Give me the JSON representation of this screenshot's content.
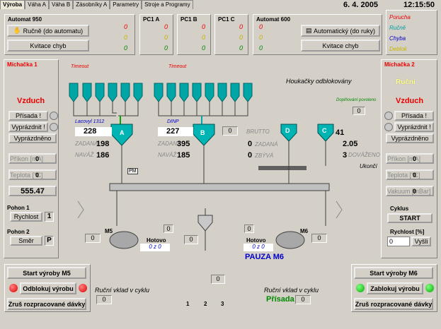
{
  "tabs": [
    "Výroba",
    "Váha A",
    "Váha B",
    "Zásobníky A",
    "Parametry",
    "Stroje a Programy"
  ],
  "date": "6. 4. 2005",
  "time": "12:15:50",
  "legend": {
    "porucha": "Porucha",
    "rucne": "Ručně",
    "chyba": "Chyba",
    "deblok": "Deblok"
  },
  "automat950": {
    "title": "Automat 950",
    "mode_btn": "Ručně (do automatu)",
    "reset_btn": "Kvitace chyb",
    "v1": "0",
    "v2": "0",
    "v3": "0"
  },
  "pc1a": {
    "title": "PC1 A",
    "v1": "0",
    "v2": "0",
    "v3": "0"
  },
  "pc1b": {
    "title": "PC1 B",
    "v1": "0",
    "v2": "0",
    "v3": "0"
  },
  "pc1c": {
    "title": "PC1 C",
    "v1": "0",
    "v2": "0",
    "v3": "0"
  },
  "automat600": {
    "title": "Automat 600",
    "mode_btn": "Automatický (do ruky)",
    "reset_btn": "Kvitace chyb",
    "v1": "0",
    "v2": "0",
    "v3": "0"
  },
  "m1": {
    "title": "Míchačka 1",
    "state": "Vzduch",
    "prisada": "Přísada !",
    "vyprazdnit": "Vyprázdnit !",
    "vyprazdneno": "Vyprázdněno",
    "prikon": "Příkon [mA]",
    "teplota": "Teplota [°C]",
    "v1": "0",
    "v2": "0",
    "v3": "555.47",
    "pohon1": "Pohon 1",
    "rychlost": "Rychlost",
    "rychlost_val": "1",
    "pohon2": "Pohon 2",
    "smer": "Směr",
    "smer_val": "P"
  },
  "m2": {
    "title": "Míchačka 2",
    "mode": "Ruční",
    "state": "Vzduch",
    "prisada": "Přísada !",
    "vyprazdnit": "Vyprázdnit !",
    "vyprazdneno": "Vyprázdněno",
    "prikon": "Příkon [mA]",
    "teplota": "Teplota [°C]",
    "vakuum": "Vakuum [mBar]",
    "v1": "0",
    "v2": "0",
    "v3": "0",
    "cyklus": "Cyklus",
    "start": "START",
    "rychlost": "Rychlost [%]",
    "rychlost_val": "0",
    "vysli": "Vyšli"
  },
  "timeout1": "Timeout",
  "timeout2": "Timeout",
  "houkacky": "Houkačky odblokovány",
  "doplnovani": "Doplňování povoleno",
  "dopl_val": "0",
  "vahaA": {
    "name": "Lacovyl 1312",
    "letter": "A",
    "brutto": "228",
    "zadana": "198",
    "naváž": "186",
    "pm": "PM"
  },
  "vahaB": {
    "name": "DINP",
    "letter": "B",
    "brutto": "227",
    "zadana": "395",
    "naváž": "185",
    "side": "0"
  },
  "vahaD": {
    "letter": "D",
    "brutto": "0",
    "zadana": "0",
    "zbyva": "0"
  },
  "vahaC": {
    "letter": "C",
    "brutto": "41",
    "zadana": "2.05",
    "dvazeno": "3"
  },
  "lbl": {
    "brutto": "BRUTTO",
    "zadana": "ZADANÁ",
    "navaz": "NAVÁŽ",
    "zbyva": "ZBÝVÁ",
    "dovazeno": "DOVÁŽENO",
    "ukonci": "Ukončí"
  },
  "m5": {
    "label": "M5",
    "val": "0",
    "hotovo": "Hotovo",
    "cyc": "0 z 0",
    "hval": "0"
  },
  "m6": {
    "label": "M6",
    "val": "0",
    "hotovo": "Hotovo",
    "cyc": "0 z 0",
    "hval": "0",
    "pauza": "PAUZA M6"
  },
  "center_val": "0",
  "center_val2": "0",
  "bottom": {
    "start_m5": "Start výroby M5",
    "odblokuj": "Odblokuj výrobu",
    "zrus": "Zruš rozpracované dávky",
    "rucni1": "Ruční vklad v cyklu",
    "r1val": "0",
    "rucni2": "Ruční vklad v cyklu",
    "prisada": "Přísada",
    "r2val": "0",
    "start_m6": "Start výroby M6",
    "zablokuj": "Zablokuj výrobu",
    "zrus2": "Zruš rozpracované dávky",
    "n1": "1",
    "n2": "2",
    "n3": "3",
    "mid": "0"
  }
}
